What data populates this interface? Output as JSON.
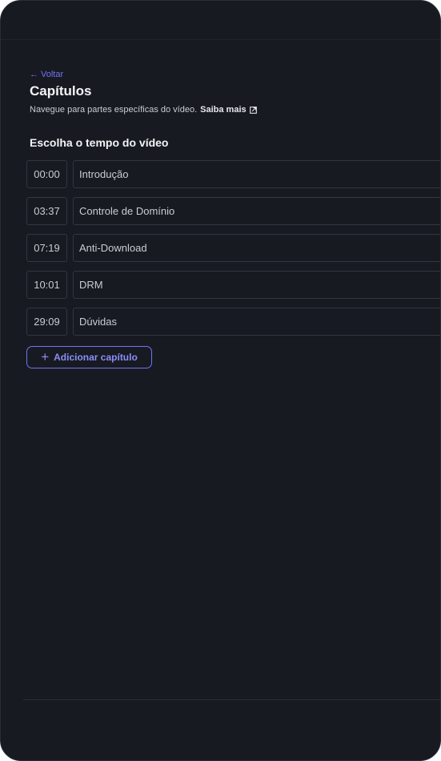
{
  "nav": {
    "back_arrow": "←",
    "back_label": "Voltar"
  },
  "header": {
    "title": "Capítulos",
    "subtitle": "Navegue para partes específicas do vídeo.",
    "learn_more": "Saiba mais",
    "learn_more_icon": "external-link-icon"
  },
  "section": {
    "title": "Escolha o tempo do vídeo"
  },
  "chapters": [
    {
      "time": "00:00",
      "title": "Introdução"
    },
    {
      "time": "03:37",
      "title": "Controle de Domínio"
    },
    {
      "time": "07:19",
      "title": "Anti-Download"
    },
    {
      "time": "10:01",
      "title": "DRM"
    },
    {
      "time": "29:09",
      "title": "Dúvidas"
    }
  ],
  "actions": {
    "add_icon": "+",
    "add_label": "Adicionar capítulo"
  },
  "colors": {
    "background": "#181a22",
    "accent": "#6f74f5",
    "border": "#33363f",
    "text": "#c9ccd3",
    "heading": "#f3f4f6"
  }
}
